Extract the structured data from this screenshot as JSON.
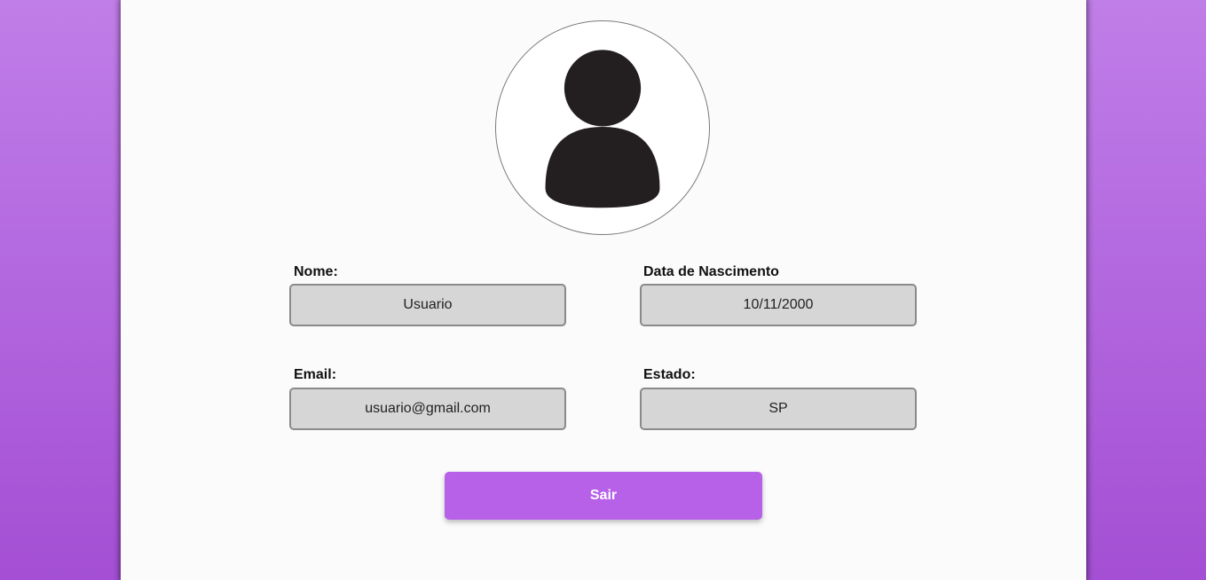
{
  "profile": {
    "fields": {
      "nome": {
        "label": "Nome:",
        "value": "Usuario"
      },
      "data_nascimento": {
        "label": "Data de Nascimento",
        "value": "10/11/2000"
      },
      "email": {
        "label": "Email:",
        "value": "usuario@gmail.com"
      },
      "estado": {
        "label": "Estado:",
        "value": "SP"
      }
    },
    "logout_label": "Sair",
    "avatar_icon": "user-silhouette-icon"
  },
  "colors": {
    "background_gradient_top": "#c07ee8",
    "background_gradient_bottom": "#a44fd4",
    "panel": "#fbfbfb",
    "field_background": "#d6d6d6",
    "field_border": "#8a8a8a",
    "button": "#b661e8",
    "button_text": "#ffffff",
    "icon": "#231f20"
  }
}
